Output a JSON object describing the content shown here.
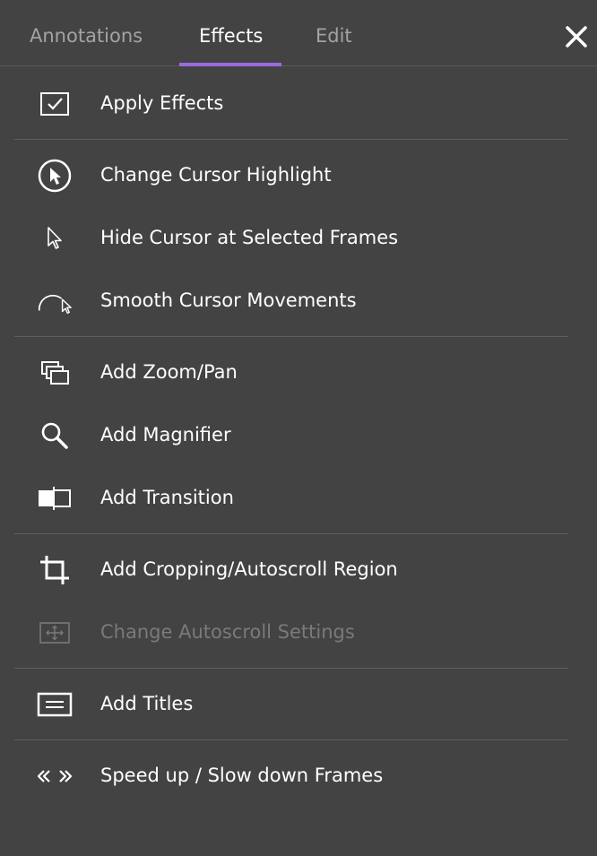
{
  "tabs": [
    {
      "label": "Annotations"
    },
    {
      "label": "Effects"
    },
    {
      "label": "Edit"
    }
  ],
  "active_tab": "Effects",
  "accent_color": "#9b6ae0",
  "menu": {
    "apply_effects": {
      "label": "Apply Effects",
      "icon": "checkbox-checked-icon"
    },
    "change_cursor_highlight": {
      "label": "Change Cursor Highlight",
      "icon": "cursor-highlight-icon"
    },
    "hide_cursor": {
      "label": "Hide Cursor at Selected Frames",
      "icon": "cursor-arrow-icon"
    },
    "smooth_cursor": {
      "label": "Smooth Cursor Movements",
      "icon": "smooth-cursor-icon"
    },
    "zoom_pan": {
      "label": "Add Zoom/Pan",
      "icon": "zoom-pan-icon"
    },
    "magnifier": {
      "label": "Add Magnifier",
      "icon": "magnifier-icon"
    },
    "transition": {
      "label": "Add Transition",
      "icon": "transition-icon"
    },
    "cropping": {
      "label": "Add Cropping/Autoscroll Region",
      "icon": "crop-icon"
    },
    "autoscroll_settings": {
      "label": "Change Autoscroll Settings",
      "icon": "autoscroll-icon",
      "disabled": true
    },
    "titles": {
      "label": "Add Titles",
      "icon": "titles-icon"
    },
    "speed": {
      "label": "Speed up / Slow down Frames",
      "icon": "speed-icon"
    }
  }
}
